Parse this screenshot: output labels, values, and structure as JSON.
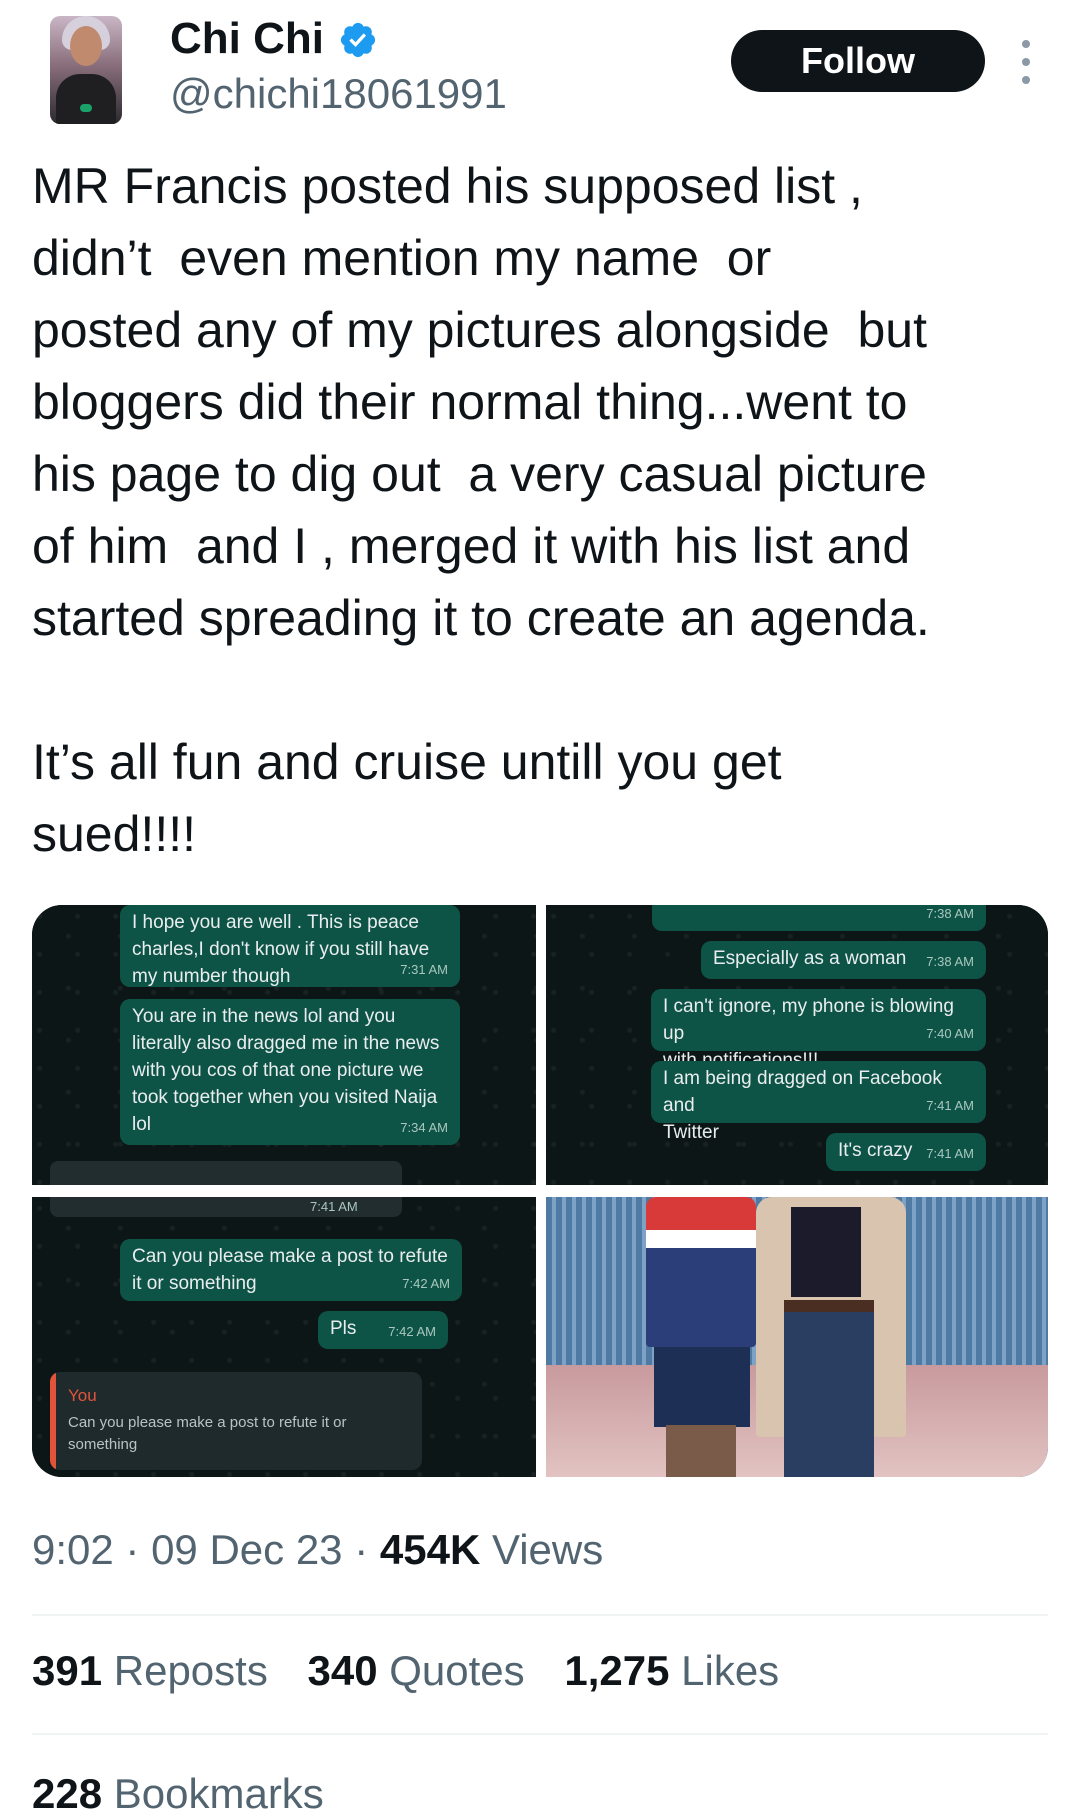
{
  "author": {
    "display_name": "Chi Chi",
    "handle": "@chichi18061991",
    "verified": true,
    "verified_color": "#1d9bf0"
  },
  "follow_label": "Follow",
  "tweet_text": "MR Francis posted his supposed list ,\ndidn’t  even mention my name  or\nposted any of my pictures alongside  but\nbloggers did their normal thing...went to\nhis page to dig out  a very casual picture\nof him  and I , merged it with his list and\nstarted spreading it to create an agenda.\n\nIt’s all fun and cruise untill you get\nsued!!!!",
  "media": {
    "screenshot1": {
      "messages": [
        {
          "text": "I hope you are well . This is peace\ncharles,I don't know if you still have\nmy number though",
          "time": "7:31 AM"
        },
        {
          "text": "You are in the news lol and you\nliterally also dragged me in the news\nwith you cos of that one picture we\ntook together when you visited Naija\nlol",
          "time": "7:34 AM"
        }
      ]
    },
    "screenshot2": {
      "messages": [
        {
          "text": "",
          "time": "7:38 AM"
        },
        {
          "text": "Especially as a woman",
          "time": "7:38 AM"
        },
        {
          "text": "I can't ignore, my phone is blowing up\nwith notifications!!!",
          "time": "7:40 AM"
        },
        {
          "text": "I am being dragged on Facebook and\nTwitter",
          "time": "7:41 AM"
        },
        {
          "text": "It's crazy",
          "time": "7:41 AM"
        }
      ]
    },
    "screenshot3": {
      "top_time": "7:41 AM",
      "messages": [
        {
          "text": "Can you please make a post to refute\nit or something",
          "time": "7:42 AM"
        },
        {
          "text": "Pls",
          "time": "7:42 AM"
        }
      ],
      "reply": {
        "author": "You",
        "text": "Can you please make a post to refute it or something"
      }
    }
  },
  "meta": {
    "time": "9:02",
    "date": "09 Dec 23",
    "views_count": "454K",
    "views_label": "Views"
  },
  "stats": {
    "reposts": {
      "count": "391",
      "label": "Reposts"
    },
    "quotes": {
      "count": "340",
      "label": "Quotes"
    },
    "likes": {
      "count": "1,275",
      "label": "Likes"
    },
    "bookmarks": {
      "count": "228",
      "label": "Bookmarks"
    }
  }
}
